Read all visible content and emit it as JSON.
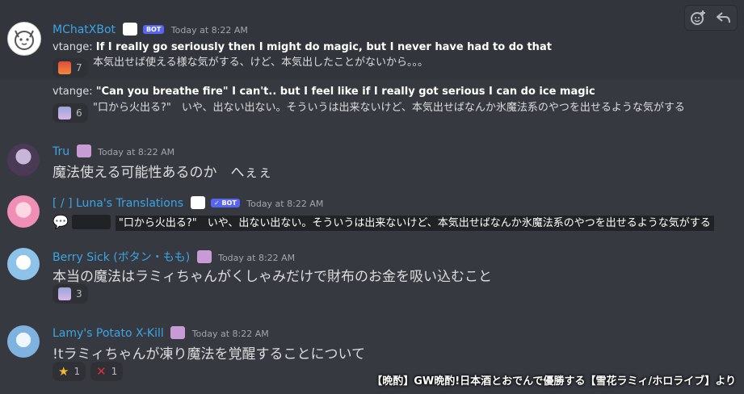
{
  "messages": [
    {
      "author": "MChatXBot",
      "bot_badge": "BOT",
      "time": "Today at 8:22 AM",
      "color": "#3ba5e6",
      "lines": [
        {
          "prefix": "vtange: ",
          "en": "If I really go seriously then I might do magic, but I never have had to do that",
          "jp": "本気出せば使える様な気がする、けど、本気出したことがないから。。。"
        },
        {
          "prefix": "vtange: ",
          "en": "\"Can you breathe fire\" I can't.. but I feel like if I really got serious I can do ice magic",
          "jp": "\"口から火出る?\"　いや、出ない出ない。そういうは出来ないけど、本気出せばなんか氷魔法系のやつを出せるような気がする"
        }
      ],
      "reactions": [
        {
          "emoji": "fire-emoji",
          "count": "7"
        },
        {
          "emoji": "lamy-emoji",
          "count": "6"
        }
      ]
    },
    {
      "author": "Tru",
      "time": "Today at 8:22 AM",
      "color": "#3ba5e6",
      "text": "魔法使える可能性あるのか　へぇぇ"
    },
    {
      "author": "[ / ] Luna's Translations",
      "bot_badge": "✓ BOT",
      "time": "Today at 8:22 AM",
      "color": "#3ba5e6",
      "text": "\"口から火出る?\"　いや、出ない出ない。そういうは出来ないけど、本気出せばなんか氷魔法系のやつを出せるような気がする"
    },
    {
      "author": "Berry Sick (ボタン・もも)",
      "time": "Today at 8:22 AM",
      "color": "#3ba5e6",
      "text": "本当の魔法はラミィちゃんがくしゃみだけで財布のお金を吸い込むこと",
      "reactions": [
        {
          "emoji": "lamy-emoji",
          "count": "3"
        }
      ]
    },
    {
      "author": "Lamy's Potato X-Kill",
      "time": "Today at 8:22 AM",
      "color": "#3ba5e6",
      "text": "!tラミィちゃんが凍り魔法を覚醒することについて",
      "reactions": [
        {
          "emoji": "star-emoji",
          "symbol": "★",
          "count": "1"
        },
        {
          "emoji": "cross-emoji",
          "symbol": "✕",
          "count": "1"
        }
      ]
    }
  ],
  "footer": "【晩酌】GW晩酌!日本酒とおでんで優勝する【雪花ラミィ/ホロライブ】より"
}
